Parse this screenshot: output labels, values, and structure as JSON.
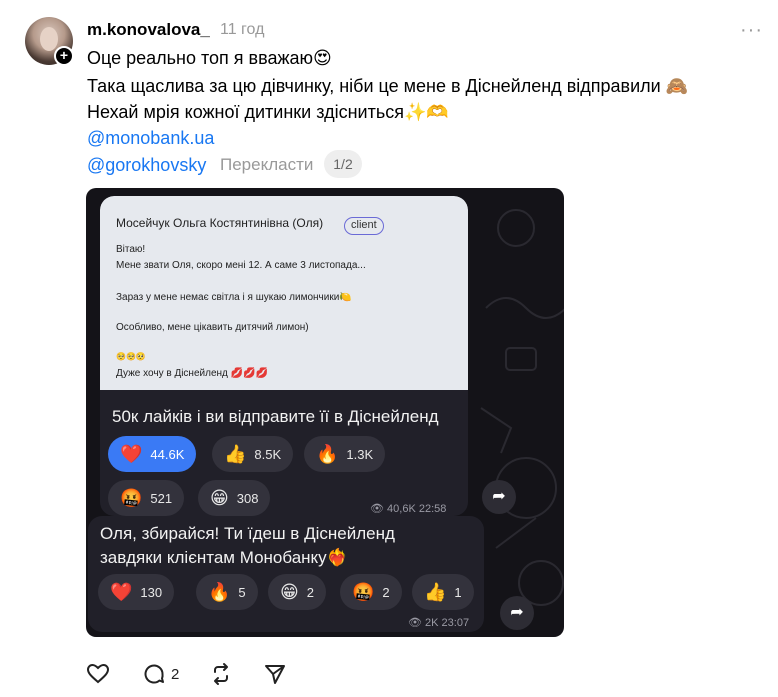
{
  "post": {
    "username": "m.konovalova_",
    "time": "11 год",
    "more": "···",
    "lines": [
      "Оце реально топ я вважаю😍",
      "Така щаслива за цю дівчинку, ніби це мене в Діснейленд відправили 🙈",
      "Нехай мрія кожної дитинки здісниться✨🫶"
    ],
    "mentions": [
      "@monobank.ua",
      "@gorokhovsky"
    ],
    "translate_label": "Перекласти",
    "pager": "1/2"
  },
  "media": {
    "card1": {
      "quote": {
        "name": "Мосейчук Ольга Костянтинівна (Оля)",
        "badge": "client",
        "lines": [
          "Вітаю!",
          "Мене звати Оля, скоро мені 12. А саме 3 листопада...",
          "Зараз у мене немає світла і я шукаю лимончики🍋",
          "Особливо, мене цікавить дитячий лимон)",
          "🥺🥺🥺",
          "Дуже хочу в Діснейленд 💋💋💋"
        ]
      },
      "title": "50к лайків і ви відправите її в Діснейленд",
      "reactions": [
        {
          "emoji": "❤️",
          "count": "44.6K"
        },
        {
          "emoji": "👍",
          "count": "8.5K"
        },
        {
          "emoji": "🔥",
          "count": "1.3K"
        },
        {
          "emoji": "🤬",
          "count": "521"
        },
        {
          "emoji": "😁",
          "count": "308"
        }
      ],
      "views": "40,6K 22:58"
    },
    "card2": {
      "line1": "Оля, збирайся! Ти їдеш в Діснейленд",
      "line2": "завдяки клієнтам Монобанку❤️‍🔥",
      "reactions": [
        {
          "emoji": "❤️",
          "count": "130"
        },
        {
          "emoji": "🔥",
          "count": "5"
        },
        {
          "emoji": "😁",
          "count": "2"
        },
        {
          "emoji": "🤬",
          "count": "2"
        },
        {
          "emoji": "👍",
          "count": "1"
        }
      ],
      "views": "2K 23:07"
    }
  },
  "actions": {
    "like_icon": "heart-icon",
    "comment_icon": "comment-icon",
    "comment_count": "2",
    "repost_icon": "repost-icon",
    "share_icon": "send-icon"
  }
}
